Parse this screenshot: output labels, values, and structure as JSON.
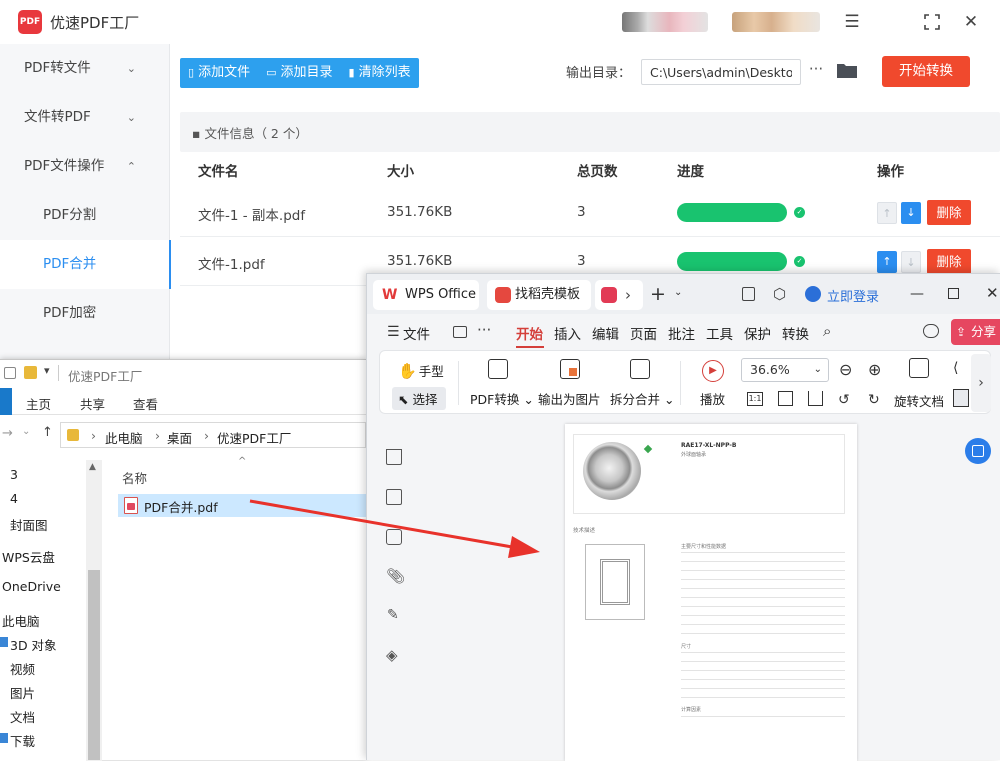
{
  "app": {
    "title": "优速PDF工厂",
    "logo_text": "PDF",
    "sidebar": [
      {
        "label": "PDF转文件",
        "chevron": "⌄"
      },
      {
        "label": "文件转PDF",
        "chevron": "⌄"
      },
      {
        "label": "PDF文件操作",
        "chevron": "⌃"
      },
      {
        "label": "PDF分割"
      },
      {
        "label": "PDF合并"
      },
      {
        "label": "PDF加密"
      }
    ],
    "toolbar": {
      "add_file": "添加文件",
      "add_dir": "添加目录",
      "clear_list": "清除列表"
    },
    "output": {
      "label": "输出目录：",
      "path": "C:\\Users\\admin\\Deskto",
      "more": "···"
    },
    "start_button": "开始转换",
    "file_info": "文件信息（ 2 个）",
    "columns": {
      "name": "文件名",
      "size": "大小",
      "pages": "总页数",
      "progress": "进度",
      "action": "操作"
    },
    "rows": [
      {
        "name": "文件-1 - 副本.pdf",
        "size": "351.76KB",
        "pages": "3",
        "progress": 100,
        "delete": "删除"
      },
      {
        "name": "文件-1.pdf",
        "size": "351.76KB",
        "pages": "3",
        "progress": 100,
        "delete": "删除"
      }
    ],
    "colors": {
      "accent": "#2da0ee",
      "primary": "#2b8ef0",
      "danger": "#f0492d",
      "success": "#19c36f"
    }
  },
  "explorer": {
    "title": "优速PDF工厂",
    "ribbon": [
      "主页",
      "共享",
      "查看"
    ],
    "breadcrumb": [
      "此电脑",
      "桌面",
      "优速PDF工厂"
    ],
    "nav": [
      "3",
      "4",
      "封面图",
      "WPS云盘",
      "OneDrive",
      "此电脑",
      "3D 对象",
      "视频",
      "图片",
      "文档",
      "下载"
    ],
    "column_header": "名称",
    "file": "PDF合并.pdf"
  },
  "wps": {
    "tabs": [
      {
        "label": "WPS Office"
      },
      {
        "label": "找稻壳模板"
      }
    ],
    "login": "立即登录",
    "menu": [
      "文件",
      "开始",
      "插入",
      "编辑",
      "页面",
      "批注",
      "工具",
      "保护",
      "转换"
    ],
    "share": "分享",
    "ribbon": {
      "hand": "手型",
      "select": "选择",
      "pdf_convert": "PDF转换",
      "export_image": "输出为图片",
      "split_merge": "拆分合并",
      "play": "播放",
      "zoom": "36.6%",
      "rotate": "旋转文档"
    },
    "doc": {
      "heading": "RAE17-XL-NPP-B",
      "sub1": "外球面轴承",
      "section1": "技术描述",
      "section2": "主要尺寸和性能数据",
      "section3": "尺寸",
      "section4": "计算因素"
    }
  }
}
